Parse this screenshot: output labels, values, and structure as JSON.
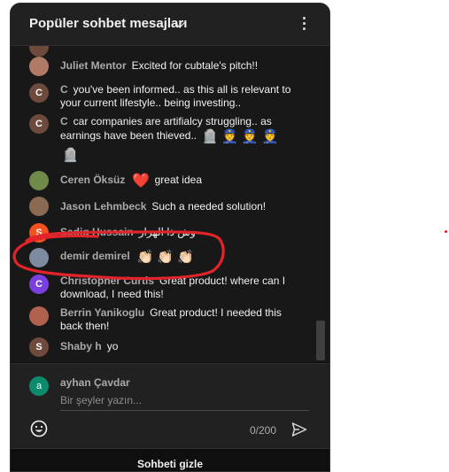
{
  "header": {
    "title": "Popüler sohbet mesajları",
    "chevron_icon": "chevron-down-icon",
    "menu_icon": "more-vert-icon"
  },
  "messages": [
    {
      "author": "Juliet Mentor",
      "text": "Excited for cubtale's pitch!!",
      "avatar": "photo",
      "avatar_color": "#a66a5a",
      "emojis": []
    },
    {
      "author": "C",
      "text": "you've been informed.. as this all is relevant to your current lifestyle.. being investing..",
      "avatar": "C",
      "avatar_color": "#6d4a3c",
      "emojis": []
    },
    {
      "author": "C",
      "text": "car companies are artifialcy struggling.. as earnings have been thieved..",
      "avatar": "C",
      "avatar_color": "#6d4a3c",
      "emojis": [
        "🪦",
        "👮",
        "👮",
        "👮",
        "🪦"
      ]
    },
    {
      "author": "Ceren Öksüz",
      "text": "great idea",
      "avatar": "photo",
      "avatar_color": "#6f8a4a",
      "emojis_before": [
        "❤️"
      ]
    },
    {
      "author": "Jason Lehmbeck",
      "text": "Such a needed solution!",
      "avatar": "photo",
      "avatar_color": "#8a6a52",
      "emojis": []
    },
    {
      "author": "Sadiq Hussain",
      "text": "وش ذا الهرار",
      "avatar": "S",
      "avatar_color": "#f4511e",
      "emojis": []
    },
    {
      "author": "demir demirel",
      "text": "",
      "avatar": "photo",
      "avatar_color": "#7d8aa0",
      "emojis": [
        "👏🏻",
        "👏🏻",
        "👏🏻"
      ]
    },
    {
      "author": "Christopher Curtis",
      "text": "Great product! where can I download, I need this!",
      "avatar": "C",
      "avatar_color": "#7b3fe0",
      "emojis": []
    },
    {
      "author": "Berrin Yanikoglu",
      "text": "Great product! I needed this back then!",
      "avatar": "photo",
      "avatar_color": "#b0624e",
      "emojis": []
    },
    {
      "author": "Shaby h",
      "text": "yo",
      "avatar": "S",
      "avatar_color": "#6d4a3c",
      "emojis": []
    }
  ],
  "composer": {
    "user_initial": "a",
    "user_name": "ayhan Çavdar",
    "placeholder": "Bir şeyler yazın...",
    "char_count": "0/200",
    "emoji_icon": "smiley-icon",
    "send_icon": "send-icon"
  },
  "footer": {
    "hide_label": "Sohbeti gizle"
  },
  "colors": {
    "panel_bg": "#0f0f0f",
    "header_bg": "#212121",
    "annotation_red": "#e0242a"
  }
}
